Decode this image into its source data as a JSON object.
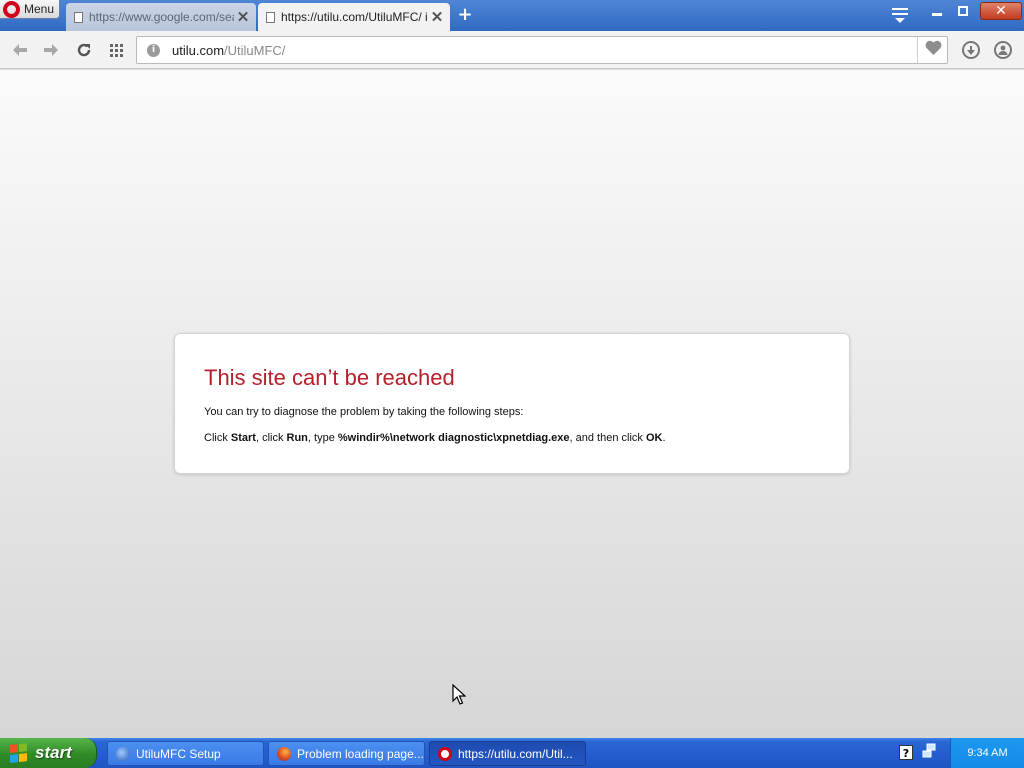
{
  "browser": {
    "menu_label": "Menu",
    "tabs": [
      {
        "title": "https://www.google.com/search",
        "active": false
      },
      {
        "title": "https://utilu.com/UtiluMFC/ is",
        "active": true
      }
    ],
    "new_tab_symbol": "+",
    "close_symbol": "✕",
    "address": {
      "host": "utilu.com",
      "path": "/UtiluMFC/"
    }
  },
  "error_page": {
    "title": "This site can’t be reached",
    "hint": "You can try to diagnose the problem by taking the following steps:",
    "steps": {
      "t1": "Click ",
      "b1": "Start",
      "t2": ", click ",
      "b2": "Run",
      "t3": ", type ",
      "b3": "%windir%\\network diagnostic\\xpnetdiag.exe",
      "t4": ", and then click ",
      "b4": "OK",
      "t5": "."
    },
    "title_color": "#b5202b"
  },
  "taskbar": {
    "start_label": "start",
    "tasks": [
      {
        "label": "UtiluMFC Setup",
        "icon": "utilumfc-icon",
        "active": false
      },
      {
        "label": "Problem loading page...",
        "icon": "firefox-icon",
        "active": false
      },
      {
        "label": "https://utilu.com/Util...",
        "icon": "opera-icon",
        "active": true
      }
    ],
    "clock": "9:34 AM",
    "help_glyph": "?"
  },
  "colors": {
    "xp_blue": "#245ed0",
    "start_green": "#2f8b27",
    "tray_blue": "#128ce6"
  }
}
